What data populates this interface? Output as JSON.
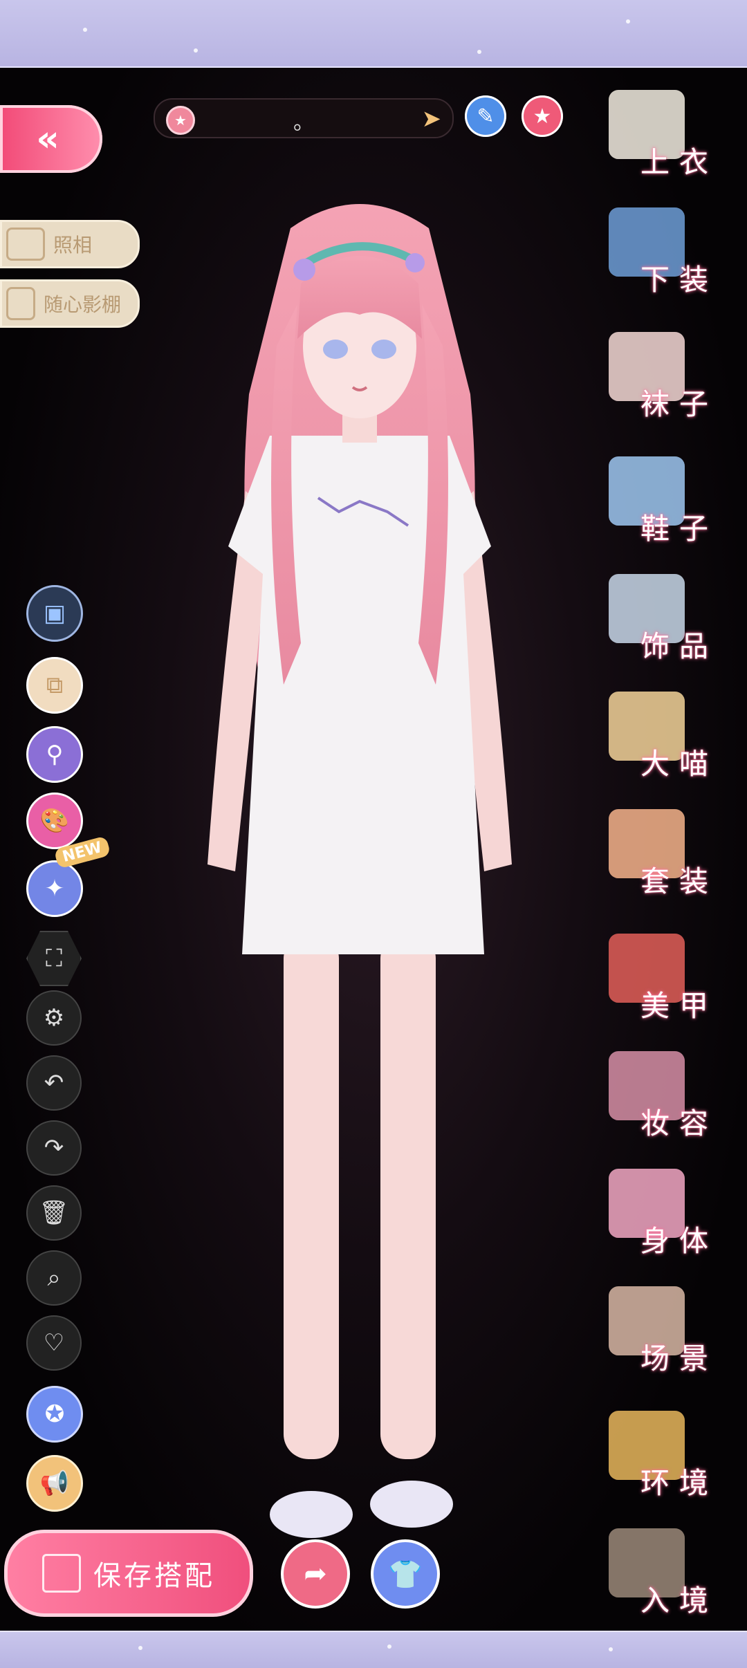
{
  "side_buttons": {
    "photo_label": "照相",
    "studio_label": "随心影棚"
  },
  "search": {
    "value": "。"
  },
  "left_tools": {
    "new_badge": "NEW"
  },
  "categories": [
    {
      "label": "上衣",
      "icon": "top-icon",
      "color": "#f3ede2"
    },
    {
      "label": "下装",
      "icon": "shorts-icon",
      "color": "#6f9fd8"
    },
    {
      "label": "袜子",
      "icon": "sock-icon",
      "color": "#f6d9d6"
    },
    {
      "label": "鞋子",
      "icon": "heel-icon",
      "color": "#9fc8f2"
    },
    {
      "label": "饰品",
      "icon": "tiara-icon",
      "color": "#c9d8ea"
    },
    {
      "label": "大喵",
      "icon": "cat-icon",
      "color": "#f5d49a"
    },
    {
      "label": "套装",
      "icon": "outfit-icon",
      "color": "#f7b48c"
    },
    {
      "label": "美甲",
      "icon": "nail-polish-icon",
      "color": "#e35f59"
    },
    {
      "label": "妆容",
      "icon": "makeup-icon",
      "color": "#d78fa7"
    },
    {
      "label": "身体",
      "icon": "body-icon",
      "color": "#f3a8c4"
    },
    {
      "label": "场景",
      "icon": "scene-icon",
      "color": "#d9b8a6"
    },
    {
      "label": "环境",
      "icon": "moon-icon",
      "color": "#e9b75d"
    },
    {
      "label": "入境",
      "icon": "window-icon",
      "color": "#9c8a7a"
    }
  ],
  "bottom": {
    "save_label": "保存搭配"
  },
  "colors": {
    "accent_pink": "#f24a77",
    "accent_blue": "#6f8df0",
    "gold": "#f2c27a"
  }
}
